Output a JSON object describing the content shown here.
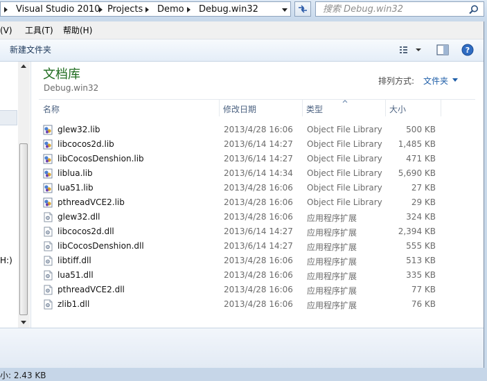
{
  "address_bar": {
    "crumbs": [
      "Visual Studio 2010",
      "Projects",
      "Demo",
      "Debug.win32"
    ]
  },
  "search": {
    "placeholder": "搜索 Debug.win32"
  },
  "menu": {
    "items": [
      "(V)",
      "工具(T)",
      "帮助(H)"
    ]
  },
  "toolbar": {
    "new_folder": "新建文件夹"
  },
  "nav": {
    "partial_text": "H:)"
  },
  "library": {
    "title": "文档库",
    "subtitle": "Debug.win32",
    "arrange_label": "排列方式:",
    "arrange_value": "文件夹"
  },
  "columns": {
    "name": "名称",
    "date": "修改日期",
    "type": "类型",
    "size": "大小"
  },
  "files": [
    {
      "name": "glew32.lib",
      "date": "2013/4/28 16:06",
      "type": "Object File Library",
      "size": "500 KB",
      "icon": "lib-file-icon"
    },
    {
      "name": "libcocos2d.lib",
      "date": "2013/6/14 14:27",
      "type": "Object File Library",
      "size": "1,485 KB",
      "icon": "lib-file-icon"
    },
    {
      "name": "libCocosDenshion.lib",
      "date": "2013/6/14 14:27",
      "type": "Object File Library",
      "size": "471 KB",
      "icon": "lib-file-icon"
    },
    {
      "name": "liblua.lib",
      "date": "2013/6/14 14:34",
      "type": "Object File Library",
      "size": "5,690 KB",
      "icon": "lib-file-icon"
    },
    {
      "name": "lua51.lib",
      "date": "2013/4/28 16:06",
      "type": "Object File Library",
      "size": "27 KB",
      "icon": "lib-file-icon"
    },
    {
      "name": "pthreadVCE2.lib",
      "date": "2013/4/28 16:06",
      "type": "Object File Library",
      "size": "29 KB",
      "icon": "lib-file-icon"
    },
    {
      "name": "glew32.dll",
      "date": "2013/4/28 16:06",
      "type": "应用程序扩展",
      "size": "324 KB",
      "icon": "dll-file-icon"
    },
    {
      "name": "libcocos2d.dll",
      "date": "2013/6/14 14:27",
      "type": "应用程序扩展",
      "size": "2,394 KB",
      "icon": "dll-file-icon"
    },
    {
      "name": "libCocosDenshion.dll",
      "date": "2013/6/14 14:27",
      "type": "应用程序扩展",
      "size": "555 KB",
      "icon": "dll-file-icon"
    },
    {
      "name": "libtiff.dll",
      "date": "2013/4/28 16:06",
      "type": "应用程序扩展",
      "size": "513 KB",
      "icon": "dll-file-icon"
    },
    {
      "name": "lua51.dll",
      "date": "2013/4/28 16:06",
      "type": "应用程序扩展",
      "size": "335 KB",
      "icon": "dll-file-icon"
    },
    {
      "name": "pthreadVCE2.dll",
      "date": "2013/4/28 16:06",
      "type": "应用程序扩展",
      "size": "77 KB",
      "icon": "dll-file-icon"
    },
    {
      "name": "zlib1.dll",
      "date": "2013/4/28 16:06",
      "type": "应用程序扩展",
      "size": "76 KB",
      "icon": "dll-file-icon"
    }
  ],
  "status": {
    "text": "小: 2.43 KB"
  },
  "colors": {
    "library_title": "#1e6b1e",
    "link_blue": "#1e5ea8",
    "header_text": "#4d6382"
  }
}
